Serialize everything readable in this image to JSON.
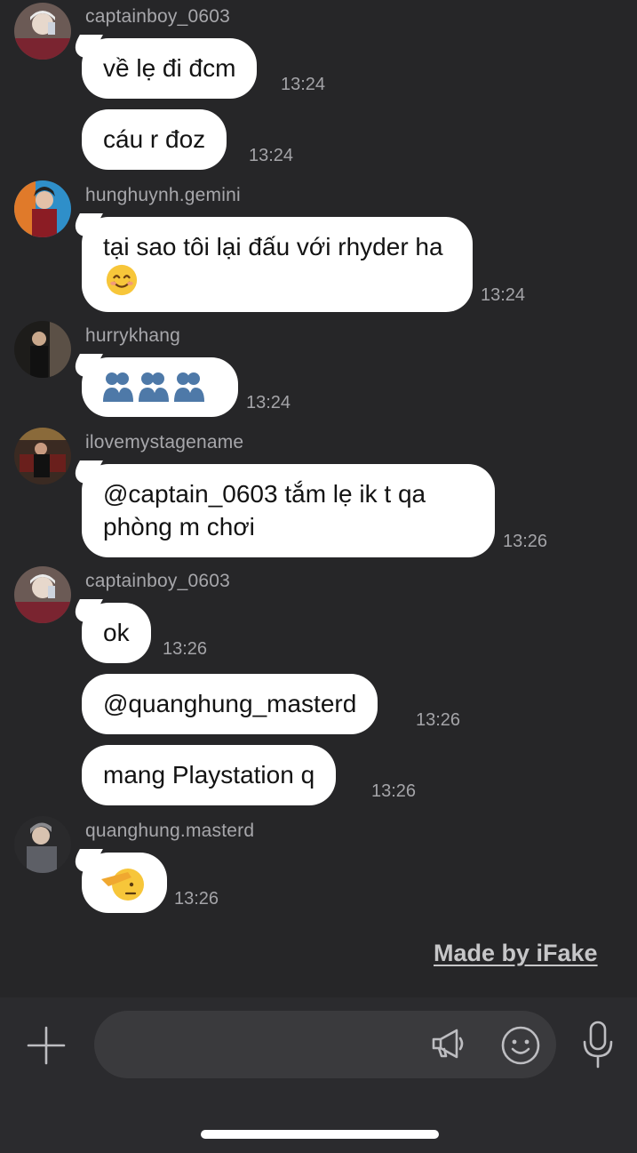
{
  "messages": [
    {
      "username": "captainboy_0603",
      "text": "về lẹ đi đcm",
      "time": "13:24"
    },
    {
      "text": "cáu r đoz",
      "time": "13:24"
    },
    {
      "username": "hunghuynh.gemini",
      "text": "tại sao tôi lại đấu với rhyder ha",
      "time": "13:24"
    },
    {
      "username": "hurrykhang",
      "text": "",
      "time": "13:24",
      "emoji": "people-silhouette-emoji x3"
    },
    {
      "username": "ilovemystagename",
      "text": "@captain_0603 tắm lẹ ik t qa phòng m chơi",
      "time": "13:26"
    },
    {
      "username": "captainboy_0603",
      "text": "ok",
      "time": "13:26"
    },
    {
      "text": "@quanghung_masterd",
      "time": "13:26"
    },
    {
      "text": "mang Playstation q",
      "time": "13:26"
    },
    {
      "username": "quanghung.masterd",
      "text": "",
      "time": "13:26",
      "emoji": "saluting-face-emoji"
    }
  ],
  "watermark": "Made by iFake",
  "composer": {
    "icons": [
      "plus-icon",
      "megaphone-icon",
      "smile-icon",
      "microphone-icon"
    ]
  },
  "colors": {
    "background": "#262628",
    "bubble": "#ffffff",
    "text_secondary": "#a7a7ab"
  }
}
